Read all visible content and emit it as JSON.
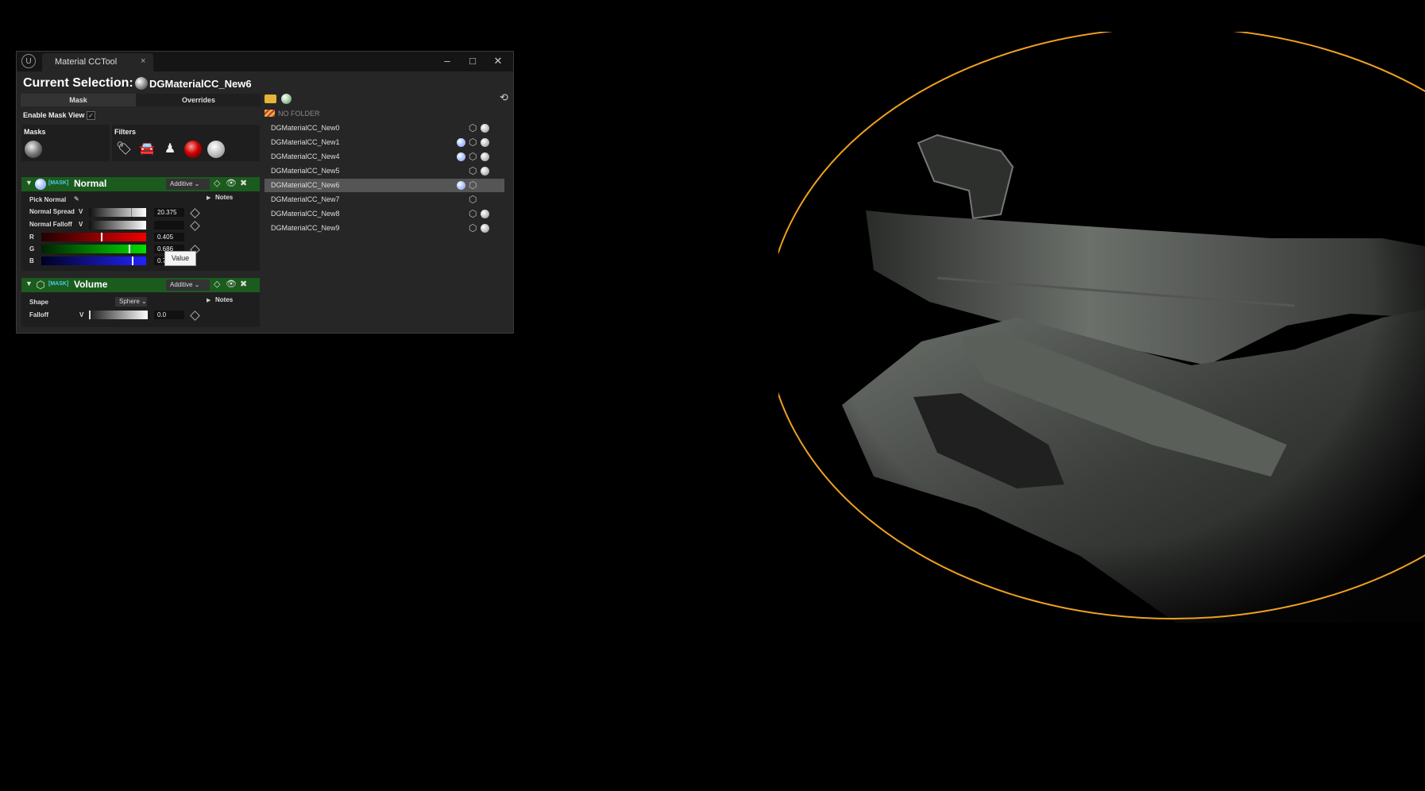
{
  "window": {
    "logo": "U",
    "tab_title": "Material CCTool",
    "tab_close": "×",
    "minimize": "–",
    "maximize": "□",
    "close": "✕"
  },
  "selection": {
    "label": "Current Selection:",
    "name": "DGMaterialCC_New6"
  },
  "subtabs": {
    "mask": "Mask",
    "overrides": "Overrides"
  },
  "enable_mask_view": {
    "label": "Enable Mask View",
    "checked": true,
    "check_glyph": "✓"
  },
  "masks": {
    "title": "Masks"
  },
  "filters": {
    "title": "Filters",
    "items": [
      {
        "icon": "tag-icon",
        "glyph": "🏷"
      },
      {
        "icon": "car-icon",
        "glyph": "🚘"
      },
      {
        "icon": "bottle-icon",
        "glyph": "♟"
      },
      {
        "icon": "red-material-ball-icon",
        "glyph": ""
      },
      {
        "icon": "white-material-ball-icon",
        "glyph": ""
      }
    ]
  },
  "layer_normal": {
    "tag": "[MASK]",
    "name": "Normal",
    "blend": "Additive ⌄",
    "pick_normal": "Pick Normal",
    "notes": "Notes",
    "normal_spread": {
      "label": "Normal Spread",
      "flag": "V",
      "value": "20.375",
      "level": 0.8
    },
    "normal_falloff": {
      "label": "Normal Falloff",
      "flag": "V"
    },
    "r": {
      "label": "R",
      "value": "0.405",
      "level": 0.57
    },
    "g": {
      "label": "G",
      "value": "0.686",
      "level": 0.83
    },
    "b": {
      "label": "B",
      "value": "0.72",
      "level": 0.86
    },
    "tooltip": "Value"
  },
  "layer_volume": {
    "tag": "[MASK]",
    "name": "Volume",
    "blend": "Additive ⌄",
    "notes": "Notes",
    "shape_label": "Shape",
    "shape_value": "Sphere ⌄",
    "falloff": {
      "label": "Falloff",
      "flag": "V",
      "value": "0.0"
    }
  },
  "list": {
    "folder": "NO FOLDER",
    "rows": [
      {
        "name": "DGMaterialCC_New0",
        "pastel": false,
        "selected": false,
        "white": true
      },
      {
        "name": "DGMaterialCC_New1",
        "pastel": true,
        "selected": false,
        "white": true
      },
      {
        "name": "DGMaterialCC_New4",
        "pastel": true,
        "selected": false,
        "white": true
      },
      {
        "name": "DGMaterialCC_New5",
        "pastel": false,
        "selected": false,
        "white": true
      },
      {
        "name": "DGMaterialCC_New6",
        "pastel": true,
        "selected": true,
        "white": false
      },
      {
        "name": "DGMaterialCC_New7",
        "pastel": false,
        "selected": false,
        "white": false
      },
      {
        "name": "DGMaterialCC_New8",
        "pastel": false,
        "selected": false,
        "white": true
      },
      {
        "name": "DGMaterialCC_New9",
        "pastel": false,
        "selected": false,
        "white": true
      }
    ]
  },
  "colors": {
    "layer_header": "#1b5b1e",
    "volume_outline": "#f0a020",
    "mask_tag": "#4ec9e6"
  }
}
